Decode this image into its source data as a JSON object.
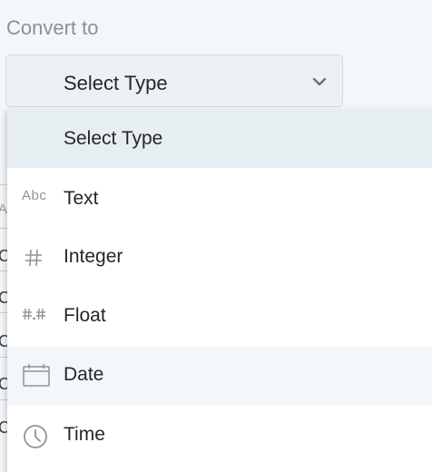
{
  "convert": {
    "label": "Convert to",
    "selected": "Select Type"
  },
  "menu": {
    "header": "Select Type",
    "items": [
      {
        "label": "Text",
        "icon": "abc-icon"
      },
      {
        "label": "Integer",
        "icon": "hash-icon"
      },
      {
        "label": "Float",
        "icon": "decimal-icon"
      },
      {
        "label": "Date",
        "icon": "calendar-icon"
      },
      {
        "label": "Time",
        "icon": "clock-icon"
      }
    ],
    "text_icon_glyph": "Abc"
  },
  "background_fragments": [
    "A",
    "C",
    "C",
    "C",
    "C",
    "C"
  ],
  "colors": {
    "page_bg": "#f4f7fa",
    "header_bg": "#e6eef1",
    "hover_bg": "#f3f7fa",
    "icon": "#8e949a"
  }
}
